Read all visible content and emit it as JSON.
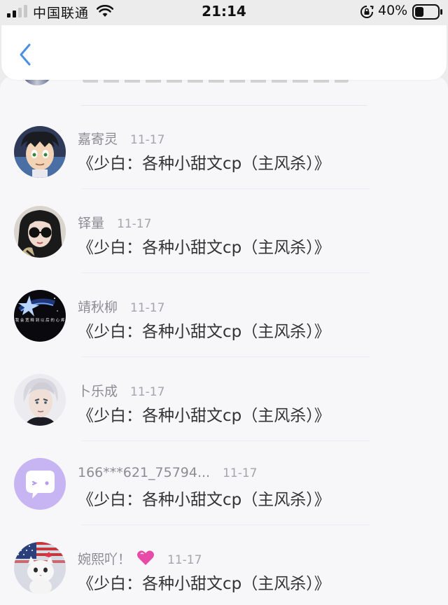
{
  "status_bar": {
    "carrier": "中国联通",
    "time": "21:14",
    "battery": "40%",
    "icons": [
      "signal-icon",
      "wifi-icon",
      "rotation-lock-icon",
      "battery-icon"
    ]
  },
  "navbar": {
    "back_icon": "chevron-left-icon"
  },
  "comments": [
    {
      "name": "嘉寄灵",
      "date": "11-17",
      "content": "《少白：各种小甜文cp（主风杀）》",
      "avatar": "anime-boy"
    },
    {
      "name": "铎量",
      "date": "11-17",
      "content": "《少白：各种小甜文cp（主风杀）》",
      "avatar": "sunglasses-girl"
    },
    {
      "name": "靖秋柳",
      "date": "11-17",
      "content": "《少白：各种小甜文cp（主风杀）》",
      "avatar": "dark-star"
    },
    {
      "name": "卜乐成",
      "date": "11-17",
      "content": "《少白：各种小甜文cp（主风杀）》",
      "avatar": "silver-hair"
    },
    {
      "name": "166***621_75794...",
      "date": "11-17",
      "content": "《少白：各种小甜文cp（主风杀）》",
      "avatar": "purple-chat"
    },
    {
      "name": "婉熙吖！",
      "date": "11-17",
      "content": "《少白：各种小甜文cp（主风杀）》",
      "avatar": "cat-flag",
      "emoji": "heart-emoji"
    }
  ],
  "colors": {
    "accent": "#4a90e2",
    "name_gray": "#8c8c92",
    "text": "#333333"
  }
}
